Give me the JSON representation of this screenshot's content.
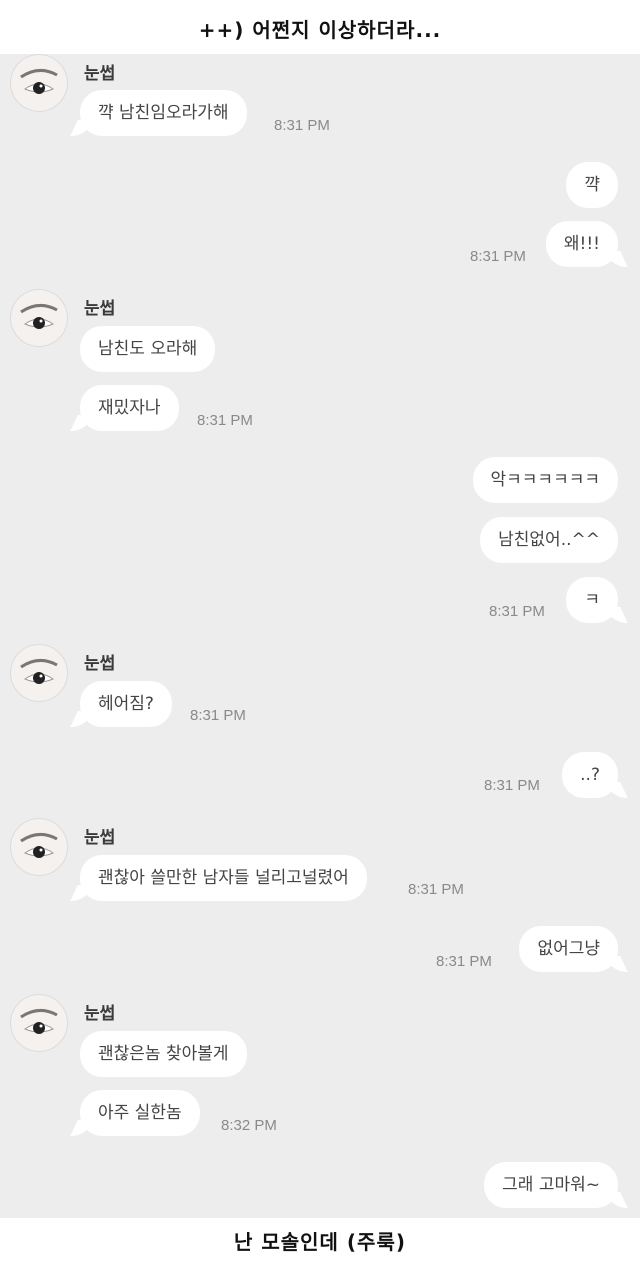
{
  "top_caption": "++) 어쩐지 이상하더라...",
  "bottom_caption": "난 모솔인데 (주룩)",
  "sender_name": "눈썹",
  "messages": {
    "m1": "꺅 남친임오라가해",
    "t1": "8:31 PM",
    "m2": "꺅",
    "m3": "왜!!!",
    "t2": "8:31 PM",
    "m4": "남친도 오라해",
    "m5": "재밌자나",
    "t3": "8:31 PM",
    "m6": "악ㅋㅋㅋㅋㅋㅋ",
    "m7": "남친없어..^^",
    "m8": "ㅋ",
    "t4": "8:31 PM",
    "m9": "헤어짐?",
    "t5": "8:31 PM",
    "m10": "..?",
    "t6": "8:31 PM",
    "m11": "괜찮아 쓸만한 남자들 널리고널렸어",
    "t7": "8:31 PM",
    "m12": "없어그냥",
    "t8": "8:31 PM",
    "m13": "괜찮은놈 찾아볼게",
    "m14": "아주 실한놈",
    "t9": "8:32 PM",
    "m15": "그래 고마워~"
  },
  "colors": {
    "chat_background": "#ededee",
    "bubble": "#ffffff",
    "timestamp": "#8a8a8a"
  },
  "icons": {
    "avatar": "eye-avatar-icon"
  }
}
